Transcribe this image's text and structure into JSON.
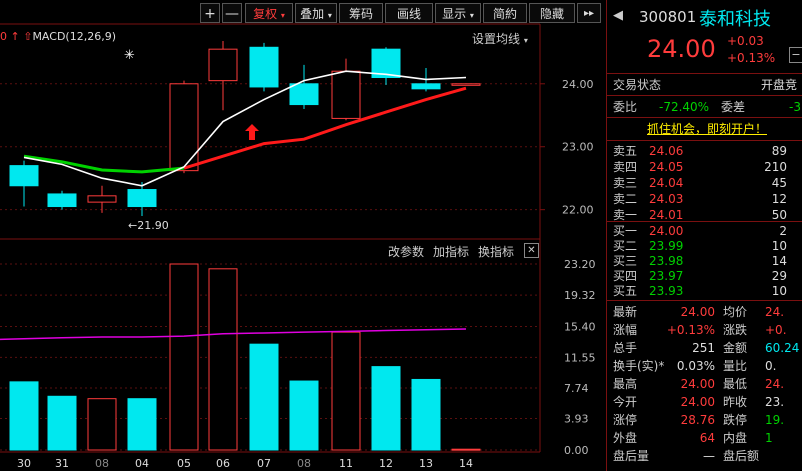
{
  "toolbar": {
    "plus": "+",
    "minus": "—",
    "fuquan": "复权",
    "diejia": "叠加",
    "chouma": "筹码",
    "huaxian": "画线",
    "xianshi": "显示",
    "jianyue": "简約",
    "yincang": "隐藏",
    "more": "▸▸"
  },
  "chart": {
    "indicator_prefix": "0 ↑",
    "indicator_label": "MACD(12,26,9)",
    "settings_label": "设置均线",
    "star": "✳",
    "low_marker": "←21.90",
    "price_ticks": [
      "24.00",
      "23.00",
      "22.00"
    ],
    "sub_buttons": [
      "改参数",
      "加指标",
      "换指标"
    ],
    "close_icon": "✕",
    "vol_ticks": [
      "23.20",
      "19.32",
      "15.40",
      "11.55",
      "7.74",
      "3.93",
      "0.00"
    ],
    "dates": [
      "30",
      "31",
      "08",
      "04",
      "05",
      "06",
      "07",
      "08",
      "11",
      "12",
      "13",
      "14"
    ]
  },
  "chart_data": {
    "type": "candlestick",
    "x": [
      "30",
      "31",
      "08",
      "04",
      "05",
      "06",
      "07",
      "08",
      "11",
      "12",
      "13",
      "14"
    ],
    "candles": [
      {
        "open": 22.7,
        "close": 22.38,
        "high": 22.78,
        "low": 22.05
      },
      {
        "open": 22.25,
        "close": 22.05,
        "high": 22.3,
        "low": 22.0
      },
      {
        "open": 22.12,
        "close": 22.22,
        "high": 22.38,
        "low": 21.95
      },
      {
        "open": 22.32,
        "close": 22.05,
        "high": 22.44,
        "low": 21.9
      },
      {
        "open": 22.62,
        "close": 24.0,
        "high": 24.05,
        "low": 22.58
      },
      {
        "open": 24.05,
        "close": 24.55,
        "high": 24.68,
        "low": 23.58
      },
      {
        "open": 24.58,
        "close": 23.95,
        "high": 24.65,
        "low": 23.88
      },
      {
        "open": 24.0,
        "close": 23.67,
        "high": 24.3,
        "low": 23.6
      },
      {
        "open": 23.45,
        "close": 24.2,
        "high": 24.4,
        "low": 23.42
      },
      {
        "open": 24.55,
        "close": 24.1,
        "high": 24.58,
        "low": 23.98
      },
      {
        "open": 24.0,
        "close": 23.92,
        "high": 24.25,
        "low": 23.88
      },
      {
        "open": 24.0,
        "close": 24.0,
        "high": 24.0,
        "low": 24.0
      }
    ],
    "ma_white": [
      22.83,
      22.72,
      22.5,
      22.38,
      22.68,
      23.4,
      23.75,
      24.05,
      24.2,
      24.15,
      24.07,
      24.1
    ],
    "ma_green": [
      22.85,
      22.76,
      22.63,
      22.6,
      22.66,
      null,
      null,
      null,
      null,
      null,
      null,
      null
    ],
    "ma_red": [
      null,
      null,
      null,
      null,
      22.66,
      22.85,
      23.05,
      23.12,
      23.35,
      23.55,
      23.75,
      23.93
    ],
    "volume": [
      8.5,
      6.7,
      6.4,
      6.4,
      23.2,
      22.6,
      13.2,
      8.6,
      14.7,
      10.4,
      8.8,
      0.1
    ],
    "vol_ma": [
      13.8,
      14.0,
      14.1,
      14.1,
      14.2,
      14.5,
      14.6,
      14.7,
      14.8,
      14.9,
      15.0,
      15.1
    ],
    "price_range": [
      21.55,
      24.95
    ],
    "vol_range": [
      0,
      23.2
    ],
    "colors": {
      "up": "#ff3c3c",
      "down": "#00e8ef",
      "ma_white": "#ffffff",
      "ma_green": "#00d200",
      "ma_red": "#ff1a1a",
      "vol_ma": "#e000e0"
    }
  },
  "header": {
    "code": "300801",
    "name": "泰和科技",
    "price": "24.00",
    "change": "+0.03",
    "change_pct": "+0.13%"
  },
  "status": {
    "label": "交易状态",
    "value": "开盘竞"
  },
  "ratio": {
    "weibi_label": "委比",
    "weibi_value": "-72.40%",
    "weicha_label": "委差",
    "weicha_value": "-3"
  },
  "banner": "抓住机会，即刻开户！",
  "asks": [
    {
      "label": "卖五",
      "price": "24.06",
      "qty": "89"
    },
    {
      "label": "卖四",
      "price": "24.05",
      "qty": "210"
    },
    {
      "label": "卖三",
      "price": "24.04",
      "qty": "45"
    },
    {
      "label": "卖二",
      "price": "24.03",
      "qty": "12"
    },
    {
      "label": "卖一",
      "price": "24.01",
      "qty": "50"
    }
  ],
  "bids": [
    {
      "label": "买一",
      "price": "24.00",
      "qty": "2"
    },
    {
      "label": "买二",
      "price": "23.99",
      "qty": "10"
    },
    {
      "label": "买三",
      "price": "23.98",
      "qty": "14"
    },
    {
      "label": "买四",
      "price": "23.97",
      "qty": "29"
    },
    {
      "label": "买五",
      "price": "23.93",
      "qty": "10"
    }
  ],
  "stats": [
    {
      "l1": "最新",
      "v1": "24.00",
      "c1": "red",
      "l2": "均价",
      "v2": "24.",
      "c2": "red"
    },
    {
      "l1": "涨幅",
      "v1": "+0.13%",
      "c1": "red",
      "l2": "涨跌",
      "v2": "+0.",
      "c2": "red"
    },
    {
      "l1": "总手",
      "v1": "251",
      "c1": "white",
      "l2": "金额",
      "v2": "60.24",
      "c2": "cyan"
    },
    {
      "l1": "换手(实)*",
      "v1": "0.03%",
      "c1": "white",
      "l2": "量比",
      "v2": "0.",
      "c2": "white"
    },
    {
      "l1": "最高",
      "v1": "24.00",
      "c1": "red",
      "l2": "最低",
      "v2": "24.",
      "c2": "red"
    },
    {
      "l1": "今开",
      "v1": "24.00",
      "c1": "red",
      "l2": "昨收",
      "v2": "23.",
      "c2": "white"
    },
    {
      "l1": "涨停",
      "v1": "28.76",
      "c1": "red",
      "l2": "跌停",
      "v2": "19.",
      "c2": "green"
    },
    {
      "l1": "外盘",
      "v1": "64",
      "c1": "red",
      "l2": "内盘",
      "v2": "1",
      "c2": "green"
    },
    {
      "l1": "盘后量",
      "v1": "—",
      "c1": "white",
      "l2": "盘后额",
      "v2": "",
      "c2": "white"
    }
  ]
}
